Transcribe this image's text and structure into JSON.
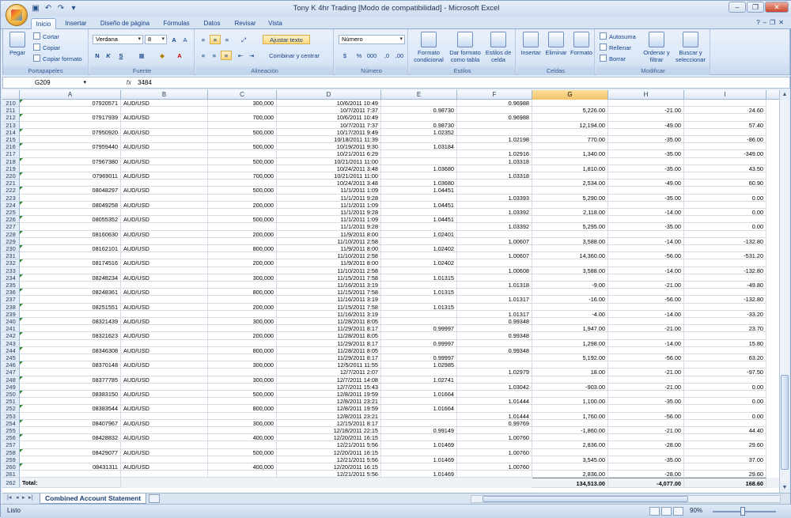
{
  "window": {
    "title": "Tony K 4hr Trading  [Modo de compatibilidad] - Microsoft Excel"
  },
  "tabs": [
    "Inicio",
    "Insertar",
    "Diseño de página",
    "Fórmulas",
    "Datos",
    "Revisar",
    "Vista"
  ],
  "ribbon": {
    "clipboard": {
      "paste": "Pegar",
      "cut": "Cortar",
      "copy": "Copiar",
      "format": "Copiar formato",
      "label": "Portapapeles"
    },
    "font": {
      "name": "Verdana",
      "size": "8",
      "label": "Fuente"
    },
    "align": {
      "wrap": "Ajustar texto",
      "merge": "Combinar y centrar",
      "label": "Alineación"
    },
    "number": {
      "format": "Número",
      "label": "Número"
    },
    "styles": {
      "cond": "Formato condicional",
      "table": "Dar formato como tabla",
      "cell": "Estilos de celda",
      "label": "Estilos"
    },
    "cells": {
      "insert": "Insertar",
      "delete": "Eliminar",
      "format": "Formato",
      "label": "Celdas"
    },
    "edit": {
      "autosum": "Autosuma",
      "fill": "Rellenar",
      "clear": "Borrar",
      "sort": "Ordenar y filtrar",
      "find": "Buscar y seleccionar",
      "label": "Modificar"
    }
  },
  "formula_bar": {
    "namebox": "G209",
    "fx": "fx",
    "value": "3484"
  },
  "columns": [
    "A",
    "B",
    "C",
    "D",
    "E",
    "F",
    "G",
    "H",
    "I"
  ],
  "selected_column": "G",
  "rows": [
    [
      "210",
      "07920571",
      "AUD/USD",
      "300,000",
      "10/6/2011 10:49",
      "",
      "0.96988",
      "",
      "",
      ""
    ],
    [
      "211",
      "",
      "",
      "",
      "10/7/2011 7:37",
      "0.98730",
      "",
      "5,226.00",
      "-21.00",
      "24.60"
    ],
    [
      "212",
      "07917939",
      "AUD/USD",
      "700,000",
      "10/6/2011 10:49",
      "",
      "0.96988",
      "",
      "",
      ""
    ],
    [
      "213",
      "",
      "",
      "",
      "10/7/2011 7:37",
      "0.98730",
      "",
      "12,194.00",
      "-49.00",
      "57.40"
    ],
    [
      "214",
      "07950920",
      "AUD/USD",
      "500,000",
      "10/17/2011 9:49",
      "1.02352",
      "",
      "",
      "",
      ""
    ],
    [
      "215",
      "",
      "",
      "",
      "10/18/2011 11:39",
      "",
      "1.02198",
      "770.00",
      "-35.00",
      "-86.00"
    ],
    [
      "216",
      "07959440",
      "AUD/USD",
      "500,000",
      "10/19/2011 9:30",
      "1.03184",
      "",
      "",
      "",
      ""
    ],
    [
      "217",
      "",
      "",
      "",
      "10/21/2011 6:29",
      "",
      "1.02916",
      "1,340.00",
      "-35.00",
      "-349.00"
    ],
    [
      "218",
      "07967380",
      "AUD/USD",
      "500,000",
      "10/21/2011 11:00",
      "",
      "1.03318",
      "",
      "",
      ""
    ],
    [
      "219",
      "",
      "",
      "",
      "10/24/2011 3:48",
      "1.03680",
      "",
      "1,810.00",
      "-35.00",
      "43.50"
    ],
    [
      "220",
      "07969011",
      "AUD/USD",
      "700,000",
      "10/21/2011 11:00",
      "",
      "1.03318",
      "",
      "",
      ""
    ],
    [
      "221",
      "",
      "",
      "",
      "10/24/2011 3:48",
      "1.03680",
      "",
      "2,534.00",
      "-49.00",
      "60.90"
    ],
    [
      "222",
      "08048297",
      "AUD/USD",
      "500,000",
      "11/1/2011 1:09",
      "1.04451",
      "",
      "",
      "",
      ""
    ],
    [
      "223",
      "",
      "",
      "",
      "11/1/2011 9:28",
      "",
      "1.03393",
      "5,290.00",
      "-35.00",
      "0.00"
    ],
    [
      "224",
      "08049258",
      "AUD/USD",
      "200,000",
      "11/1/2011 1:09",
      "1.04451",
      "",
      "",
      "",
      ""
    ],
    [
      "225",
      "",
      "",
      "",
      "11/1/2011 9:28",
      "",
      "1.03392",
      "2,118.00",
      "-14.00",
      "0.00"
    ],
    [
      "226",
      "08055352",
      "AUD/USD",
      "500,000",
      "11/1/2011 1:09",
      "1.04451",
      "",
      "",
      "",
      ""
    ],
    [
      "227",
      "",
      "",
      "",
      "11/1/2011 9:28",
      "",
      "1.03392",
      "5,295.00",
      "-35.00",
      "0.00"
    ],
    [
      "228",
      "08160630",
      "AUD/USD",
      "200,000",
      "11/9/2011 8:00",
      "1.02401",
      "",
      "",
      "",
      ""
    ],
    [
      "229",
      "",
      "",
      "",
      "11/10/2011 2:58",
      "",
      "1.00607",
      "3,588.00",
      "-14.00",
      "-132.80"
    ],
    [
      "230",
      "08162101",
      "AUD/USD",
      "800,000",
      "11/9/2011 8:00",
      "1.02402",
      "",
      "",
      "",
      ""
    ],
    [
      "231",
      "",
      "",
      "",
      "11/10/2011 2:58",
      "",
      "1.00607",
      "14,360.00",
      "-56.00",
      "-531.20"
    ],
    [
      "232",
      "08174516",
      "AUD/USD",
      "200,000",
      "11/9/2011 8:00",
      "1.02402",
      "",
      "",
      "",
      ""
    ],
    [
      "233",
      "",
      "",
      "",
      "11/10/2011 2:58",
      "",
      "1.00608",
      "3,588.00",
      "-14.00",
      "-132.80"
    ],
    [
      "234",
      "08248234",
      "AUD/USD",
      "300,000",
      "11/15/2011 7:58",
      "1.01315",
      "",
      "",
      "",
      ""
    ],
    [
      "235",
      "",
      "",
      "",
      "11/16/2011 3:19",
      "",
      "1.01318",
      "-9.00",
      "-21.00",
      "-49.80"
    ],
    [
      "236",
      "08248361",
      "AUD/USD",
      "800,000",
      "11/15/2011 7:58",
      "1.01315",
      "",
      "",
      "",
      ""
    ],
    [
      "237",
      "",
      "",
      "",
      "11/16/2011 3:19",
      "",
      "1.01317",
      "-16.00",
      "-56.00",
      "-132.80"
    ],
    [
      "238",
      "08251551",
      "AUD/USD",
      "200,000",
      "11/15/2011 7:58",
      "1.01315",
      "",
      "",
      "",
      ""
    ],
    [
      "239",
      "",
      "",
      "",
      "11/16/2011 3:19",
      "",
      "1.01317",
      "-4.00",
      "-14.00",
      "-33.20"
    ],
    [
      "240",
      "08321439",
      "AUD/USD",
      "300,000",
      "11/28/2011 8:05",
      "",
      "0.99348",
      "",
      "",
      ""
    ],
    [
      "241",
      "",
      "",
      "",
      "11/29/2011 8:17",
      "0.99997",
      "",
      "1,947.00",
      "-21.00",
      "23.70"
    ],
    [
      "242",
      "08321623",
      "AUD/USD",
      "200,000",
      "11/28/2011 8:05",
      "",
      "0.99348",
      "",
      "",
      ""
    ],
    [
      "243",
      "",
      "",
      "",
      "11/29/2011 8:17",
      "0.99997",
      "",
      "1,298.00",
      "-14.00",
      "15.80"
    ],
    [
      "244",
      "08346308",
      "AUD/USD",
      "800,000",
      "11/28/2011 8:05",
      "",
      "0.99348",
      "",
      "",
      ""
    ],
    [
      "245",
      "",
      "",
      "",
      "11/29/2011 8:17",
      "0.99997",
      "",
      "5,192.00",
      "-56.00",
      "63.20"
    ],
    [
      "246",
      "08370148",
      "AUD/USD",
      "300,000",
      "12/5/2011 11:55",
      "1.02985",
      "",
      "",
      "",
      ""
    ],
    [
      "247",
      "",
      "",
      "",
      "12/7/2011 2:07",
      "",
      "1.02979",
      "18.00",
      "-21.00",
      "-97.50"
    ],
    [
      "248",
      "08377785",
      "AUD/USD",
      "300,000",
      "12/7/2011 14:08",
      "1.02741",
      "",
      "",
      "",
      ""
    ],
    [
      "249",
      "",
      "",
      "",
      "12/7/2011 15:43",
      "",
      "1.03042",
      "-903.00",
      "-21.00",
      "0.00"
    ],
    [
      "250",
      "08383150",
      "AUD/USD",
      "500,000",
      "12/8/2011 19:59",
      "1.01664",
      "",
      "",
      "",
      ""
    ],
    [
      "251",
      "",
      "",
      "",
      "12/8/2011 23:21",
      "",
      "1.01444",
      "1,100.00",
      "-35.00",
      "0.00"
    ],
    [
      "252",
      "08383544",
      "AUD/USD",
      "800,000",
      "12/8/2011 19:59",
      "1.01664",
      "",
      "",
      "",
      ""
    ],
    [
      "253",
      "",
      "",
      "",
      "12/8/2011 23:21",
      "",
      "1.01444",
      "1,760.00",
      "-56.00",
      "0.00"
    ],
    [
      "254",
      "08407967",
      "AUD/USD",
      "300,000",
      "12/15/2011 8:17",
      "",
      "0.99769",
      "",
      "",
      ""
    ],
    [
      "255",
      "",
      "",
      "",
      "12/18/2011 22:15",
      "0.99149",
      "",
      "-1,860.00",
      "-21.00",
      "44.40"
    ],
    [
      "256",
      "08428832",
      "AUD/USD",
      "400,000",
      "12/20/2011 16:15",
      "",
      "1.00760",
      "",
      "",
      ""
    ],
    [
      "257",
      "",
      "",
      "",
      "12/21/2011 5:56",
      "1.01469",
      "",
      "2,836.00",
      "-28.00",
      "29.60"
    ],
    [
      "258",
      "08429077",
      "AUD/USD",
      "500,000",
      "12/20/2011 16:15",
      "",
      "1.00760",
      "",
      "",
      ""
    ],
    [
      "259",
      "",
      "",
      "",
      "12/21/2011 5:56",
      "1.01469",
      "",
      "3,545.00",
      "-35.00",
      "37.00"
    ],
    [
      "260",
      "08431311",
      "AUD/USD",
      "400,000",
      "12/20/2011 16:15",
      "",
      "1.00760",
      "",
      "",
      ""
    ],
    [
      "261",
      "",
      "",
      "",
      "12/21/2011 5:56",
      "1.01469",
      "",
      "2,836.00",
      "-28.00",
      "29.60"
    ]
  ],
  "total_row": {
    "num": "262",
    "label": "Total:",
    "g": "134,513.00",
    "h": "-4,077.00",
    "i": "168.60"
  },
  "sheet_tab": "Combined Account Statement",
  "status": {
    "text": "Listo",
    "zoom": "90%"
  }
}
